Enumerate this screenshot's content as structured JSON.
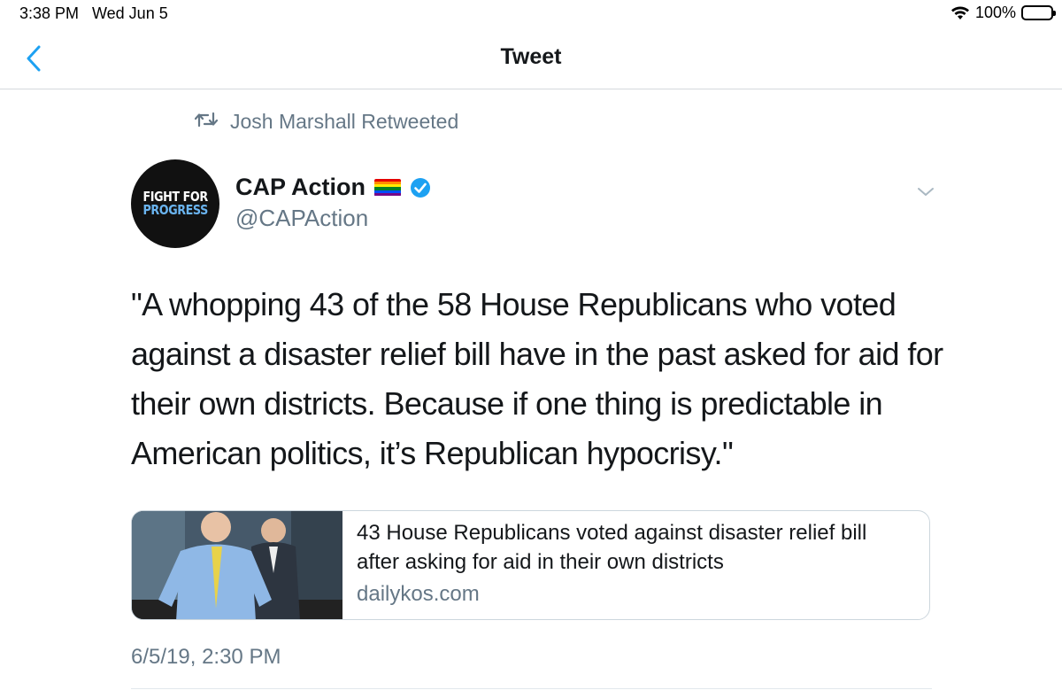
{
  "status_bar": {
    "time": "3:38 PM",
    "date": "Wed Jun 5",
    "battery": "100%",
    "icons": [
      "wifi-icon",
      "battery-icon"
    ]
  },
  "nav": {
    "title": "Tweet",
    "back_icon": "chevron-left-icon"
  },
  "retweet": {
    "icon": "retweet-icon",
    "text": "Josh Marshall Retweeted"
  },
  "author": {
    "avatar_line1": "FIGHT FOR",
    "avatar_line2": "PROGRESS",
    "name": "CAP Action",
    "handle": "@CAPAction",
    "icons": [
      "rainbow-flag-icon",
      "verified-badge-icon",
      "chevron-down-icon"
    ]
  },
  "tweet": {
    "text": "\"A whopping 43 of the 58 House Republicans who voted against a disaster relief bill have in the past asked for aid for their own districts. Because if one thing is predictable in American politics, it’s Republican hypocrisy.\"",
    "timestamp": "6/5/19, 2:30 PM"
  },
  "link_card": {
    "title": "43 House Republicans voted against disaster relief bill after asking for aid in their own districts",
    "domain": "dailykos.com"
  },
  "colors": {
    "accent": "#1da1f2",
    "secondary_text": "#657786",
    "primary_text": "#14171a"
  }
}
